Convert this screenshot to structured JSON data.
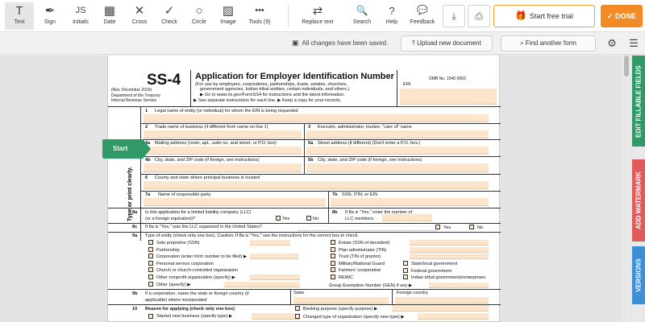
{
  "toolbar": {
    "tools": [
      {
        "label": "Text",
        "icon": "text-cursor-icon",
        "glyph": "T"
      },
      {
        "label": "Sign",
        "icon": "pen-icon",
        "glyph": "✒"
      },
      {
        "label": "Initials",
        "icon": "initials-icon",
        "glyph": "JS"
      },
      {
        "label": "Date",
        "icon": "calendar-icon",
        "glyph": "▦"
      },
      {
        "label": "Cross",
        "icon": "cross-icon",
        "glyph": "✕"
      },
      {
        "label": "Check",
        "icon": "check-icon",
        "glyph": "✓"
      },
      {
        "label": "Circle",
        "icon": "circle-icon",
        "glyph": "○"
      },
      {
        "label": "Image",
        "icon": "image-icon",
        "glyph": "▨"
      },
      {
        "label": "Tools (9)",
        "icon": "more-icon",
        "glyph": "•••"
      }
    ],
    "replace_text": {
      "label": "Replace text",
      "glyph": "⇄"
    },
    "search": {
      "label": "Search",
      "glyph": "🔍"
    },
    "help": {
      "label": "Help",
      "glyph": "?"
    },
    "feedback": {
      "label": "Feedback",
      "glyph": "💬"
    },
    "download_glyph": "⤓",
    "print_glyph": "⎙",
    "trial_label": "Start free trial",
    "trial_glyph": "🎁",
    "done_label": "DONE",
    "done_glyph": "✓"
  },
  "subbar": {
    "saved_text": "All changes have been saved.",
    "upload_label": "Upload new document",
    "find_label": "Find another form",
    "settings_glyph": "⚙",
    "list_glyph": "☰"
  },
  "side_tabs": {
    "edit": "EDIT FILLABLE FIELDS",
    "watermark": "ADD WATERMARK",
    "versions": "VERSIONS"
  },
  "start_label": "Start",
  "form": {
    "form_no": "SS-4",
    "rev": "(Rev. December 2019)",
    "dept1": "Department of the Treasury",
    "dept2": "Internal Revenue Service",
    "title": "Application for Employer Identification Number",
    "sub1": "(For use by employers, corporations, partnerships, trusts, estates, churches,",
    "sub2": "government agencies, Indian tribal entities, certain individuals, and others.)",
    "sub3": "▶ Go to www.irs.gov/FormSS4 for instructions and the latest information.",
    "sub4": "▶ See separate instructions for each line.    ▶ Keep a copy for your records.",
    "omb": "OMB No. 1545-0003",
    "ein": "EIN",
    "side_label": "Type or print clearly.",
    "l1": "Legal name of entity (or individual) for whom the EIN is being requested",
    "l2": "Trade name of business (if different from name on line 1)",
    "l3": "Executor, administrator, trustee, \"care of\" name",
    "l4a": "Mailing address (room, apt., suite no. and street, or P.O. box)",
    "l5a": "Street address (if different) (Don't enter a P.O. box.)",
    "l4b": "City, state, and ZIP code (if foreign, see instructions)",
    "l5b": "City, state, and ZIP code (if foreign, see instructions)",
    "l6": "County and state where principal business is located",
    "l7a": "Name of responsible party",
    "l7b": "SSN, ITIN, or EIN",
    "l8a_1": "Is this application for a limited liability company (LLC)",
    "l8a_2": "(or a foreign equivalent)?",
    "yes": "Yes",
    "no": "No",
    "l8b_1": "If 8a is \"Yes,\" enter the number of",
    "l8b_2": "LLC members",
    "l8c": "If 8a is \"Yes,\" was the LLC organized in the United States?",
    "l9a": "Type of entity (check only one box). Caution: If 8a is \"Yes,\" see the instructions for the correct box to check.",
    "entities_left": [
      "Sole proprietor (SSN)",
      "Partnership",
      "Corporation (enter form number to be filed) ▶",
      "Personal service corporation",
      "Church or church-controlled organization",
      "Other nonprofit organization (specify) ▶",
      "Other (specify) ▶"
    ],
    "entities_right": [
      "Estate (SSN of decedent)",
      "Plan administrator (TIN)",
      "Trust (TIN of grantor)",
      "Military/National Guard",
      "Farmers' cooperative",
      "REMIC"
    ],
    "entities_right2": [
      "State/local government",
      "Federal government",
      "Indian tribal governments/enterprises"
    ],
    "group_ex": "Group Exemption Number (GEN) if any ▶",
    "l9b_1": "If a corporation, name the state or foreign country (if",
    "l9b_2": "applicable) where incorporated",
    "state": "State",
    "foreign": "Foreign country",
    "l10": "Reason for applying (check only one box)",
    "l10_a": "Started new business (specify type) ▶",
    "l10_b": "Banking purpose (specify purpose) ▶",
    "l10_c": "Changed type of organization (specify new type) ▶",
    "n1": "1",
    "n2": "2",
    "n3": "3",
    "n4a": "4a",
    "n5a": "5a",
    "n4b": "4b",
    "n5b": "5b",
    "n6": "6",
    "n7a": "7a",
    "n7b": "7b",
    "n8a": "8a",
    "n8b": "8b",
    "n8c": "8c",
    "n9a": "9a",
    "n9b": "9b",
    "n10": "10"
  }
}
